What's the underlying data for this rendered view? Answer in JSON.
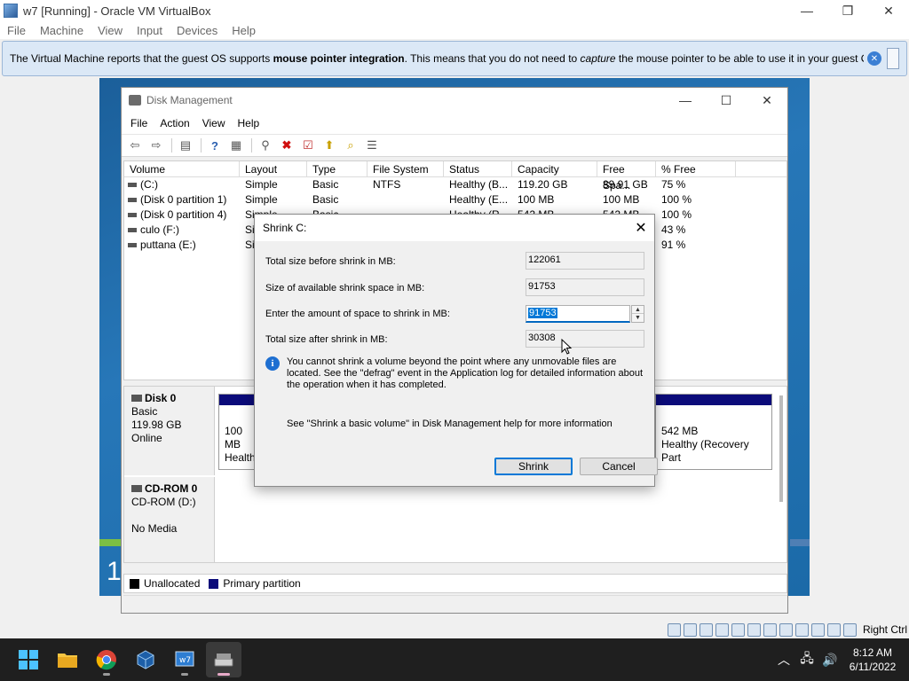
{
  "vbox": {
    "title": "w7 [Running] - Oracle VM VirtualBox",
    "menu": [
      "File",
      "Machine",
      "View",
      "Input",
      "Devices",
      "Help"
    ],
    "notice": {
      "prefix": "The Virtual Machine reports that the guest OS supports ",
      "bold": "mouse pointer integration",
      "middle": ". This means that you do not need to ",
      "italic": "capture",
      "suffix": " the mouse pointer to be able to use it in your guest OS -- all mouse"
    },
    "host_key": "Right Ctrl"
  },
  "dm": {
    "title": "Disk Management",
    "menu": [
      "File",
      "Action",
      "View",
      "Help"
    ],
    "columns": [
      "Volume",
      "Layout",
      "Type",
      "File System",
      "Status",
      "Capacity",
      "Free Spa...",
      "% Free"
    ],
    "rows": [
      [
        "(C:)",
        "Simple",
        "Basic",
        "NTFS",
        "Healthy (B...",
        "119.20 GB",
        "89.91 GB",
        "75 %"
      ],
      [
        "(Disk 0 partition 1)",
        "Simple",
        "Basic",
        "",
        "Healthy (E...",
        "100 MB",
        "100 MB",
        "100 %"
      ],
      [
        "(Disk 0 partition 4)",
        "Simple",
        "Basic",
        "",
        "Healthy (R...",
        "542 MB",
        "542 MB",
        "100 %"
      ],
      [
        "culo (F:)",
        "Simple",
        "",
        "",
        "",
        "",
        "",
        "43 %"
      ],
      [
        "puttana (E:)",
        "Simple",
        "",
        "",
        "",
        "",
        "",
        "91 %"
      ]
    ],
    "disk0": {
      "name": "Disk 0",
      "type": "Basic",
      "size": "119.98 GB",
      "state": "Online"
    },
    "part_100": {
      "size": "100 MB",
      "status": "Healthy"
    },
    "part_542": {
      "size": "542 MB",
      "status": "Healthy (Recovery Part"
    },
    "cdrom": {
      "name": "CD-ROM 0",
      "drive": "CD-ROM (D:)",
      "media": "No Media"
    },
    "legend": {
      "unallocated": "Unallocated",
      "primary": "Primary partition"
    },
    "colors": {
      "unallocated": "#000000",
      "primary": "#0b0b7a"
    }
  },
  "shrink": {
    "title": "Shrink C:",
    "total_before_label": "Total size before shrink in MB:",
    "total_before": "122061",
    "available_label": "Size of available shrink space in MB:",
    "available": "91753",
    "amount_label": "Enter the amount of space to shrink in MB:",
    "amount": "91753",
    "after_label": "Total size after shrink in MB:",
    "after": "30308",
    "info": "You cannot shrink a volume beyond the point where any unmovable files are located. See the \"defrag\" event in the Application log for detailed information about the operation when it has completed.",
    "help": "See \"Shrink a basic volume\" in Disk Management help for more information",
    "shrink_btn": "Shrink",
    "cancel_btn": "Cancel"
  },
  "clock": {
    "time": "8:12 AM",
    "date": "6/11/2022"
  }
}
